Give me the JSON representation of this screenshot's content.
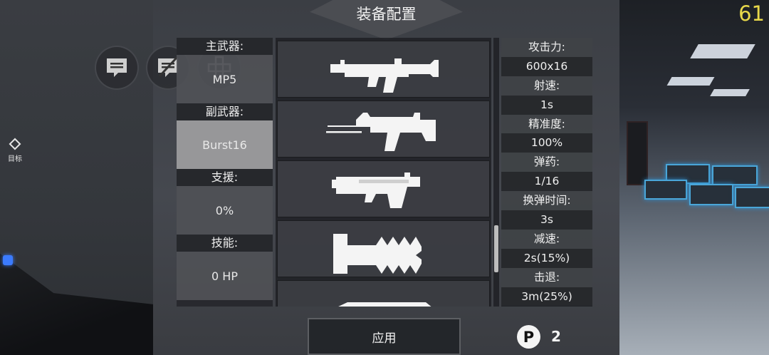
{
  "title": "装备配置",
  "fps": "61",
  "target_marker_label": "目标",
  "slots": [
    {
      "label": "主武器:",
      "value": "MP5"
    },
    {
      "label": "副武器:",
      "value": "Burst16"
    },
    {
      "label": "支援:",
      "value": "0%"
    },
    {
      "label": "技能:",
      "value": "0 HP"
    }
  ],
  "weapons": [
    {
      "icon": "assault-rifle-icon"
    },
    {
      "icon": "shotgun-rifle-icon"
    },
    {
      "icon": "heavy-launcher-icon"
    },
    {
      "icon": "spiked-melee-icon"
    },
    {
      "icon": "blade-weapon-icon"
    }
  ],
  "stats": [
    {
      "label": "攻击力:",
      "value": "600x16"
    },
    {
      "label": "射速:",
      "value": "1s"
    },
    {
      "label": "精准度:",
      "value": "100%"
    },
    {
      "label": "弹药:",
      "value": "1/16"
    },
    {
      "label": "换弹时间:",
      "value": "3s"
    },
    {
      "label": "减速:",
      "value": "2s(15%)"
    },
    {
      "label": "击退:",
      "value": "3m(25%)"
    }
  ],
  "apply_label": "应用",
  "points": {
    "icon_letter": "P",
    "value": "2"
  },
  "colors": {
    "fps": "#e8d84a",
    "crate_glow": "#4aa6d8",
    "selected_slot": "#aaaaac"
  }
}
